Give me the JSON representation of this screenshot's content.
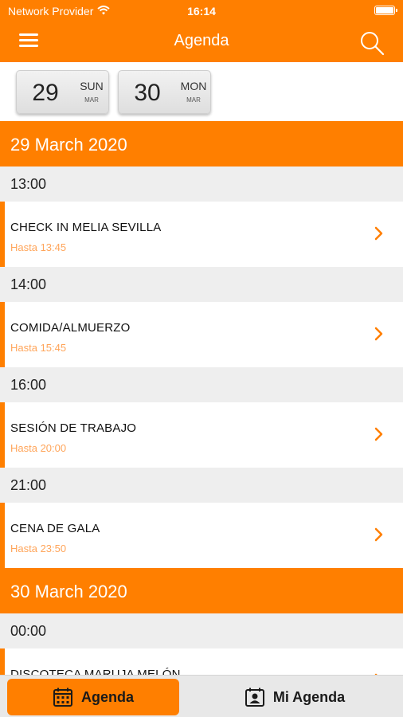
{
  "status": {
    "carrier": "Network Provider",
    "time": "16:14"
  },
  "navbar": {
    "title": "Agenda"
  },
  "dates": [
    {
      "num": "29",
      "day": "SUN",
      "month": "MAR"
    },
    {
      "num": "30",
      "day": "MON",
      "month": "MAR"
    }
  ],
  "days": [
    {
      "label": "29 March 2020",
      "slots": [
        {
          "time": "13:00",
          "name": "CHECK IN MELIA SEVILLA",
          "until": "Hasta 13:45"
        },
        {
          "time": "14:00",
          "name": "COMIDA/ALMUERZO",
          "until": "Hasta 15:45"
        },
        {
          "time": "16:00",
          "name": "SESIÓN DE TRABAJO",
          "until": "Hasta 20:00"
        },
        {
          "time": "21:00",
          "name": "CENA DE GALA",
          "until": "Hasta 23:50"
        }
      ]
    },
    {
      "label": "30 March 2020",
      "slots": [
        {
          "time": "00:00",
          "name": "DISCOTECA MARUJA MELÓN",
          "until": ""
        }
      ]
    }
  ],
  "tabs": {
    "agenda": "Agenda",
    "mi_agenda": "Mi Agenda"
  },
  "colors": {
    "accent": "#ff7f00",
    "accent_light": "#ffa55a",
    "time_band": "#eeeeee"
  }
}
